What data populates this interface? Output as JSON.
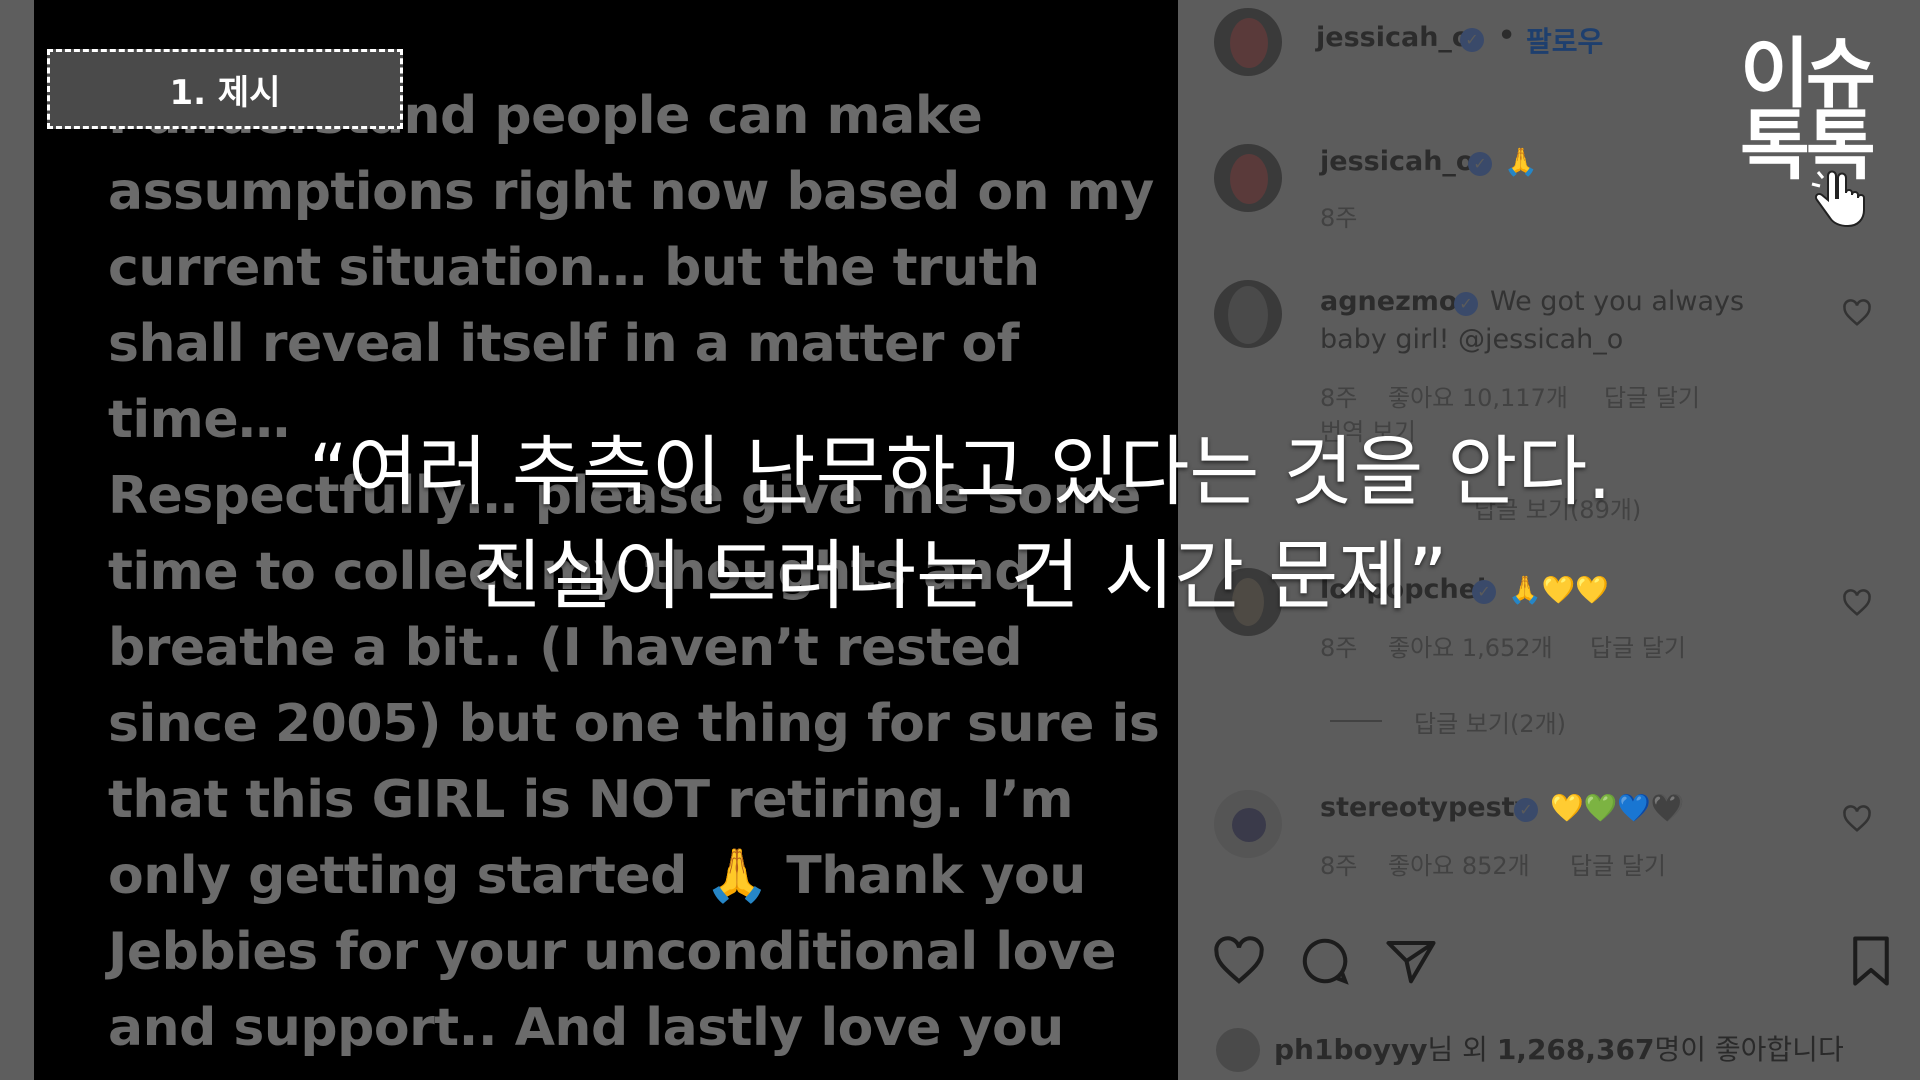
{
  "chapter_label": "1. 제시",
  "post": {
    "lines": [
      "I understand people can make",
      "assumptions right now based on my",
      "current situation… but the truth",
      "shall reveal itself in a matter of",
      "time…",
      "Respectfully… please give me some",
      "time to collect my thoughts and",
      "breathe a bit.. (I haven’t rested",
      "since 2005) but one thing for sure is",
      "that this GIRL is NOT retiring. I’m",
      "only getting started 🙏 Thank you",
      "Jebbies for your unconditional love",
      "and support.. And lastly love you"
    ]
  },
  "caption": {
    "line1": "“여러 추측이 난무하고 있다는 것을 안다.",
    "line2": "진실이 드러나는 건 시간 문제”"
  },
  "logo": {
    "line1": "이슈",
    "line2": "톡톡"
  },
  "sidebar": {
    "header": {
      "username": "jessicah_o",
      "separator": "•",
      "follow_label": "팔로우"
    },
    "caption_comment": {
      "username": "jessicah_o",
      "emoji": "🙏",
      "time": "8주"
    },
    "comments": [
      {
        "username": "agnezmo",
        "text_line1": "We got you always",
        "text_line2": "baby girl! @jessicah_o",
        "time": "8주",
        "likes": "좋아요 10,117개",
        "reply": "답글 달기",
        "translate": "번역 보기",
        "view_replies": "답글 보기(89개)"
      },
      {
        "username": "lolipopchei",
        "text": "🙏💛💛",
        "time": "8주",
        "likes": "좋아요 1,652개",
        "reply": "답글 달기",
        "view_replies": "답글 보기(2개)"
      },
      {
        "username": "stereotypestv",
        "text": "💛💚💙🖤",
        "time": "8주",
        "likes": "좋아요 852개",
        "reply": "답글 달기"
      }
    ],
    "likes_summary": {
      "user": "ph1boyyy",
      "suffix1": "님 외 ",
      "count": "1,268,367",
      "suffix2": "명이 좋아합니다"
    }
  },
  "icons": {
    "action_bar": [
      "heart-icon",
      "comment-icon",
      "share-icon",
      "bookmark-icon"
    ],
    "comment_like": "heart-icon",
    "verified": "verified-badge-icon",
    "logo_pointer": "hand-pointer-icon"
  },
  "colors": {
    "post_background": "#000000",
    "post_text": "#6b6b6b",
    "side_background": "#5c5c5c",
    "caption_text": "#ffffff",
    "follow_link": "#1e3f6e"
  }
}
